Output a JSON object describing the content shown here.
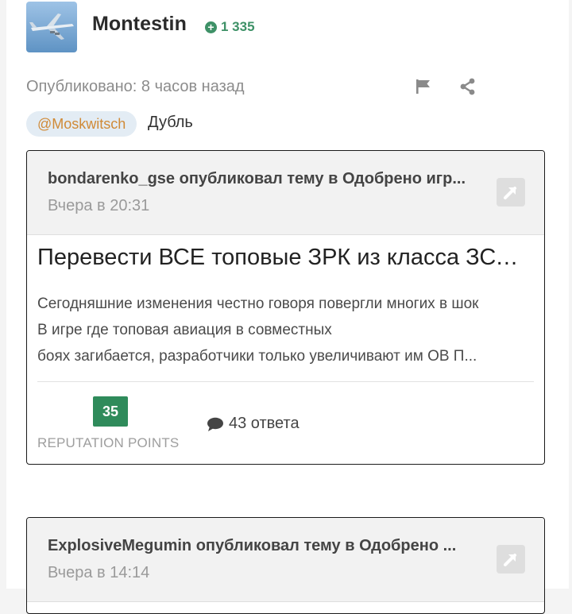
{
  "author": {
    "name": "Montestin",
    "reputation": "1 335"
  },
  "post_meta": {
    "published": "Опубликовано: 8 часов назад"
  },
  "content": {
    "mention": "@Moskwitsch",
    "text": "Дубль"
  },
  "embeds": [
    {
      "header": "bondarenko_gse опубликовал тему в Одобрено игр...",
      "time": "Вчера в 20:31",
      "title": "Перевести ВСЕ топовые ЗРК из класса ЗСУ ...",
      "body_lines": [
        "Сегодняшние изменения честно говоря повергли многих в шок",
        "В игре где топовая авиация в совместных",
        "боях загибается, разработчики только увеличивают им ОВ   П..."
      ],
      "reputation_points": "35",
      "reputation_label": "REPUTATION POINTS",
      "replies": "43 ответа"
    },
    {
      "header": "ExplosiveMegumin опубликовал тему в Одобрено ...",
      "time": "Вчера в 14:14"
    }
  ],
  "icons": [
    "flag-icon",
    "share-icon",
    "plus-circle-icon",
    "external-link-icon",
    "comment-icon"
  ],
  "colors": {
    "reputation_green": "#2f8b5b",
    "mention_bg": "#e3ecf4",
    "mention_text": "#d08a37"
  }
}
